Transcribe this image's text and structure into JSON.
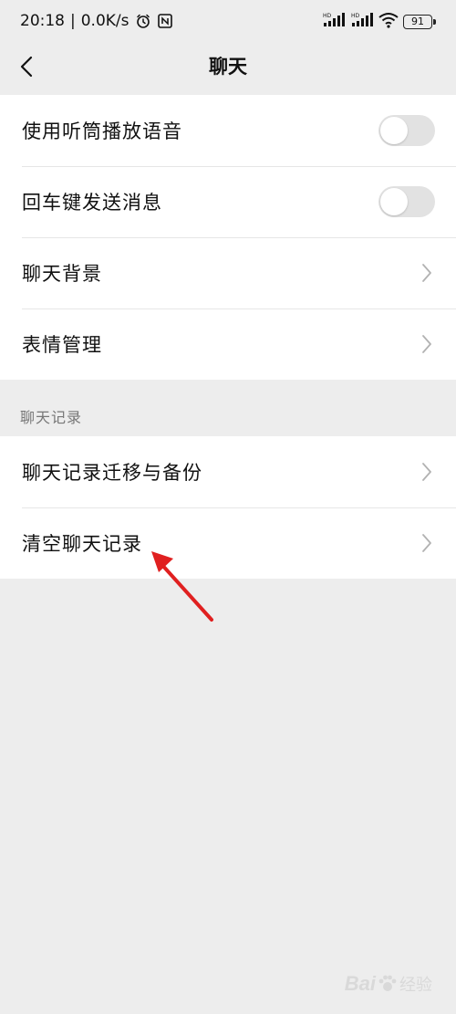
{
  "status_bar": {
    "time": "20:18",
    "separator": "|",
    "network_speed": "0.0K/s",
    "battery": "91",
    "signal_1_label": "HD",
    "signal_2_label": "HD",
    "icons": [
      "alarm-icon",
      "nfc-icon",
      "signal-icon",
      "signal-icon",
      "wifi-icon",
      "battery-icon"
    ]
  },
  "nav": {
    "title": "聊天",
    "back_icon": "back-chevron-icon"
  },
  "groups": [
    {
      "rows": [
        {
          "label": "使用听筒播放语音",
          "control": "toggle",
          "on": false
        },
        {
          "label": "回车键发送消息",
          "control": "toggle",
          "on": false
        },
        {
          "label": "聊天背景",
          "control": "chevron"
        },
        {
          "label": "表情管理",
          "control": "chevron"
        }
      ]
    },
    {
      "header": "聊天记录",
      "rows": [
        {
          "label": "聊天记录迁移与备份",
          "control": "chevron"
        },
        {
          "label": "清空聊天记录",
          "control": "chevron"
        }
      ]
    }
  ],
  "annotation": {
    "arrow_color": "#e02020",
    "points_to": "清空聊天记录"
  },
  "watermark": {
    "text": "Bai",
    "suffix": "经验",
    "icon": "paw-icon"
  },
  "colors": {
    "background": "#ededed",
    "card": "#ffffff",
    "toggle_off": "#e2e2e2",
    "chevron": "#b2b2b2"
  }
}
